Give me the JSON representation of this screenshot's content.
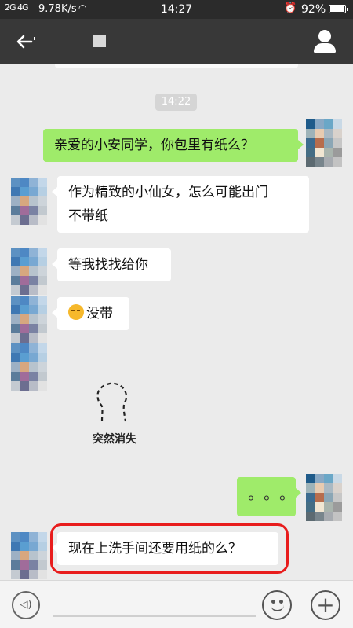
{
  "status_bar": {
    "signal": "2G 4G",
    "speed": "9.78K/s",
    "time": "14:27",
    "battery": "92%"
  },
  "header": {
    "back_icon": "back-arrow-icon",
    "profile_icon": "person-icon"
  },
  "chat": {
    "timestamp": "14:22",
    "messages": [
      {
        "side": "right",
        "text": "亲爱的小安同学，你包里有纸么？"
      },
      {
        "side": "left",
        "lines": [
          "作为精致的小仙女，怎么可能出门",
          "不带纸"
        ]
      },
      {
        "side": "left",
        "text": "等我找找给你"
      },
      {
        "side": "left",
        "emoji": "crying-laugh-emoji",
        "text": "没带"
      },
      {
        "side": "left",
        "sticker_caption": "突然消失"
      },
      {
        "side": "right",
        "text": "。。。"
      },
      {
        "side": "left",
        "text": "现在上洗手间还要用纸的么？"
      }
    ]
  },
  "input_bar": {
    "voice_icon": "voice-icon",
    "voice_glyph": "◁)",
    "emoji_icon": "smiley-icon",
    "plus_icon": "plus-icon",
    "plus_glyph": "+"
  },
  "colors": {
    "status_bar": "#2b2b2b",
    "header": "#383838",
    "chat_bg": "#ebebeb",
    "my_bubble": "#9feb6a",
    "their_bubble": "#ffffff",
    "highlight": "#e81c1c"
  }
}
